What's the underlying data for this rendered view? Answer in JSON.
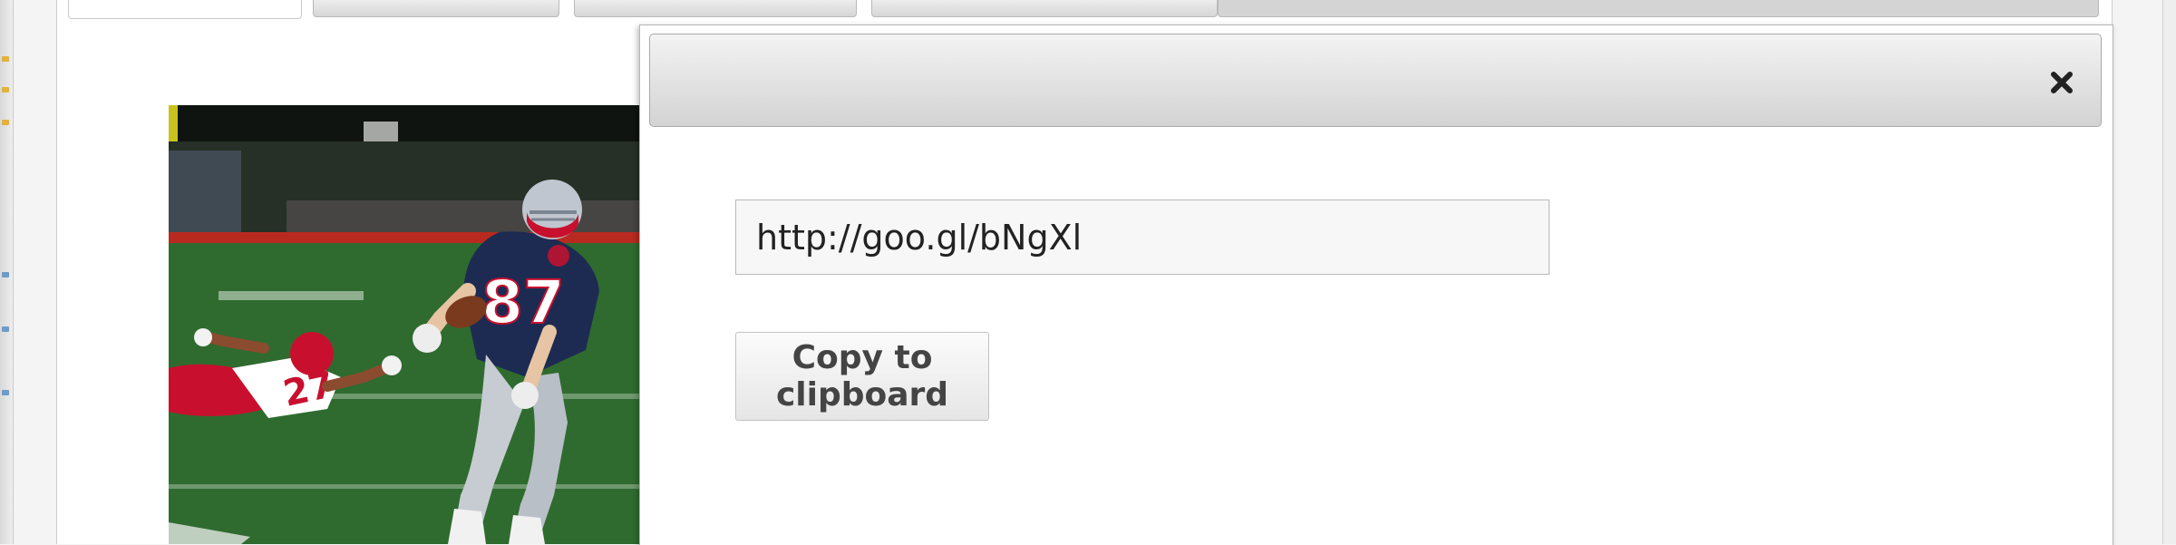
{
  "dialog": {
    "close_icon": "close-icon",
    "url_value": "http://goo.gl/bNgXl",
    "copy_label": "Copy to clipboard"
  },
  "tabs": {
    "count": 5,
    "active_index": 0
  },
  "photo": {
    "subject": "football-player-photo"
  },
  "colors": {
    "dialog_bg": "#ffffff",
    "titlebar_bg": "#d9d9d9",
    "button_text": "#444444",
    "jersey_navy": "#1d2b52",
    "opponent_red": "#c8102e",
    "field_green": "#2f6b2f"
  }
}
